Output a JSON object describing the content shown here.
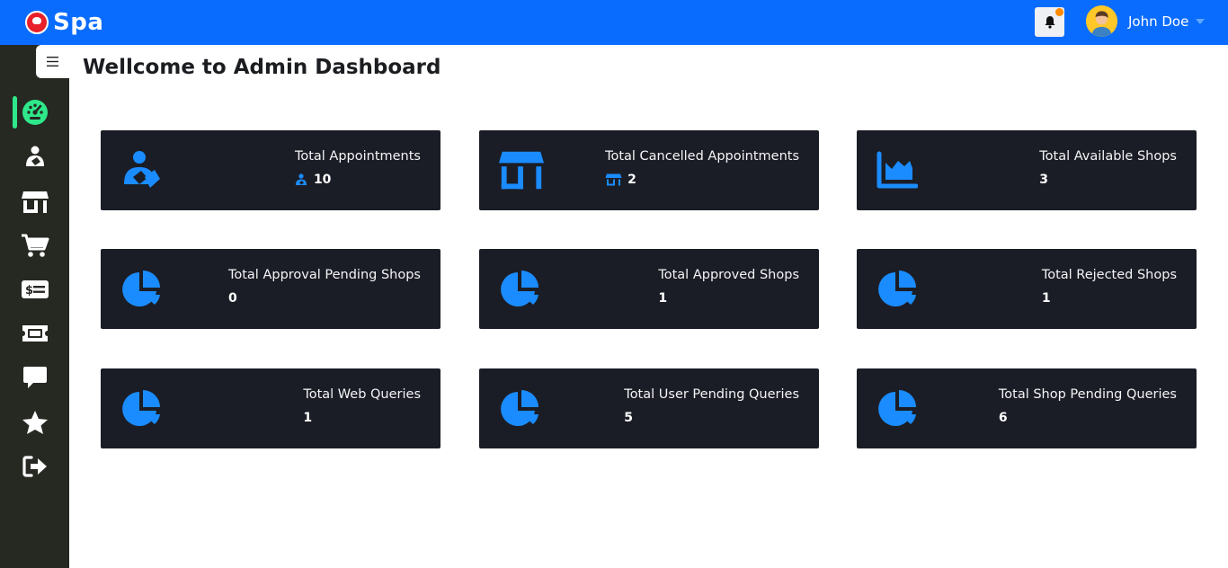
{
  "header": {
    "brand": "Spa",
    "user_name": "John Doe",
    "accent_color": "#0a6cff",
    "notification_dot_color": "#ff8a00"
  },
  "sidebar": {
    "items": [
      {
        "icon": "dashboard-icon",
        "active": true
      },
      {
        "icon": "appointment-icon",
        "active": false
      },
      {
        "icon": "shop-icon",
        "active": false
      },
      {
        "icon": "cart-icon",
        "active": false
      },
      {
        "icon": "money-bill-icon",
        "active": false
      },
      {
        "icon": "ticket-icon",
        "active": false
      },
      {
        "icon": "chat-icon",
        "active": false
      },
      {
        "icon": "star-icon",
        "active": false
      },
      {
        "icon": "logout-icon",
        "active": false
      }
    ],
    "active_color": "#2ee88a"
  },
  "main": {
    "title": "Wellcome to Admin Dashboard",
    "cards": [
      {
        "label": "Total Appointments",
        "value": "10",
        "icon": "user-heart-icon"
      },
      {
        "label": "Total Cancelled Appointments",
        "value": "2",
        "icon": "store-icon"
      },
      {
        "label": "Total Available Shops",
        "value": "3",
        "icon": "area-chart-icon"
      },
      {
        "label": "Total Approval Pending Shops",
        "value": "0",
        "icon": "pie-chart-icon"
      },
      {
        "label": "Total Approved Shops",
        "value": "1",
        "icon": "pie-chart-icon"
      },
      {
        "label": "Total Rejected Shops",
        "value": "1",
        "icon": "pie-chart-icon"
      },
      {
        "label": "Total Web Queries",
        "value": "1",
        "icon": "pie-chart-icon"
      },
      {
        "label": "Total User Pending Queries",
        "value": "5",
        "icon": "pie-chart-icon"
      },
      {
        "label": "Total Shop Pending Queries",
        "value": "6",
        "icon": "pie-chart-icon"
      }
    ],
    "card_background": "#1b1d26",
    "icon_color": "#1a8cff"
  }
}
